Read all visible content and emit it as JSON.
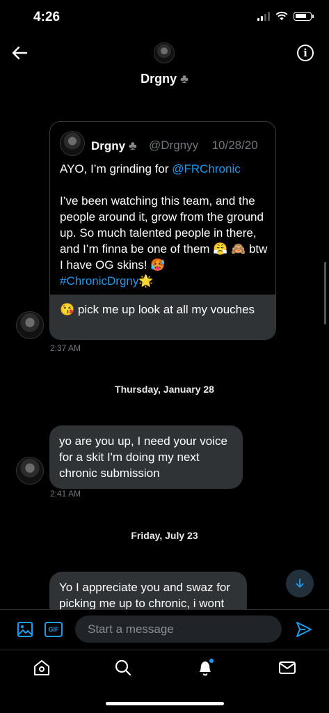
{
  "status_bar": {
    "time": "4:26"
  },
  "header": {
    "name": "Drgny",
    "badge": "♣"
  },
  "quoted_tweet": {
    "name": "Drgny",
    "badge": "♣",
    "handle": "@Drgnyy",
    "date": "10/28/20",
    "line1_prefix": "AYO, I’m grinding for ",
    "mention": "@FRChronic",
    "body": "I’ve been watching this team, and the people around it, grow from the ground up. So much talented people in there, and I’m finna be one of them 😤 🙈 btw I have OG skins! 🥵",
    "hashtag": "#ChronicDrgny",
    "hashtag_emoji": "🌟"
  },
  "messages": [
    {
      "text": "😘 pick me up look at all my vouches",
      "time": "2:37 AM"
    },
    {
      "text": "yo are you up, I need your voice for a skit I'm doing my next chronic submission",
      "time": "2:41 AM"
    },
    {
      "text": "Yo I appreciate you and swaz for picking me up to chronic, i wont"
    }
  ],
  "date_separators": [
    "Thursday, January 28",
    "Friday, July 23"
  ],
  "composer": {
    "placeholder": "Start a message",
    "gif_label": "GIF"
  },
  "tabs": [
    "home",
    "search",
    "notifications",
    "messages"
  ],
  "colors": {
    "accent": "#1d9bf0",
    "bubble": "#2f3336",
    "background": "#000000"
  }
}
